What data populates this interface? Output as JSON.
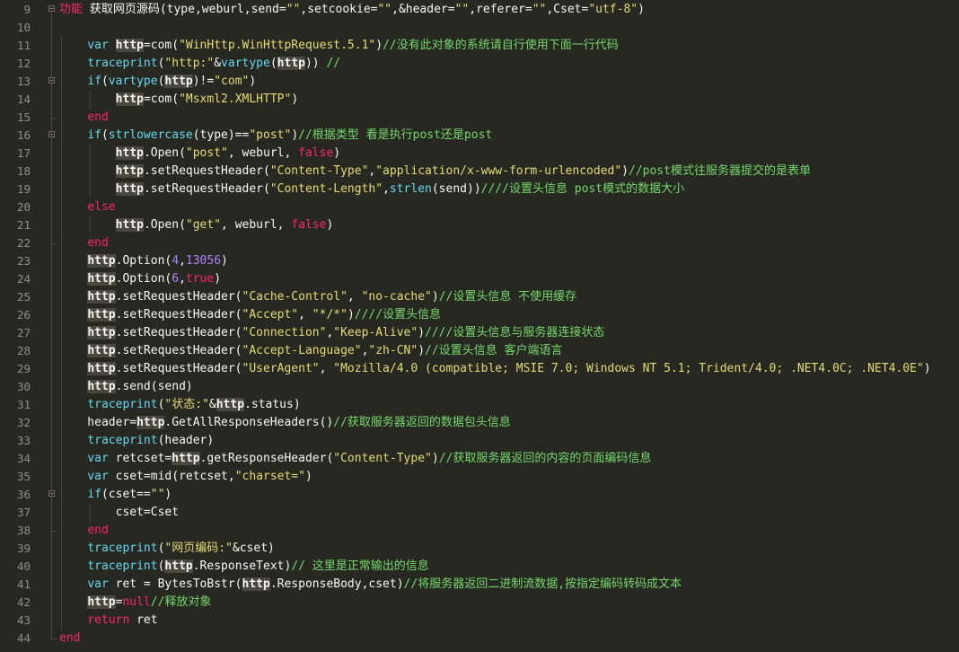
{
  "editor": {
    "lines": [
      {
        "n": "9",
        "fold": "open",
        "tokens": [
          {
            "t": "功能 ",
            "c": "ti"
          },
          {
            "t": "获取网页源码(type,weburl,send=",
            "c": ""
          },
          {
            "t": "\"\"",
            "c": "str"
          },
          {
            "t": ",setcookie=",
            "c": ""
          },
          {
            "t": "\"\"",
            "c": "str"
          },
          {
            "t": ",&header=",
            "c": ""
          },
          {
            "t": "\"\"",
            "c": "str"
          },
          {
            "t": ",referer=",
            "c": ""
          },
          {
            "t": "\"\"",
            "c": "str"
          },
          {
            "t": ",Cset=",
            "c": ""
          },
          {
            "t": "\"utf-8\"",
            "c": "str"
          },
          {
            "t": ")",
            "c": ""
          }
        ]
      },
      {
        "n": "10",
        "tokens": []
      },
      {
        "n": "11",
        "tokens": [
          {
            "t": "    ",
            "c": ""
          },
          {
            "t": "var",
            "c": "fn"
          },
          {
            "t": " ",
            "c": ""
          },
          {
            "t": "http",
            "c": "hl"
          },
          {
            "t": "=com(",
            "c": ""
          },
          {
            "t": "\"WinHttp.WinHttpRequest.5.1\"",
            "c": "str"
          },
          {
            "t": ")",
            "c": ""
          },
          {
            "t": "//没有此对象的系统请自行使用下面一行代码",
            "c": "cm"
          }
        ]
      },
      {
        "n": "12",
        "tokens": [
          {
            "t": "    ",
            "c": ""
          },
          {
            "t": "traceprint",
            "c": "fn"
          },
          {
            "t": "(",
            "c": ""
          },
          {
            "t": "\"http:\"",
            "c": "str"
          },
          {
            "t": "&",
            "c": ""
          },
          {
            "t": "vartype",
            "c": "fn"
          },
          {
            "t": "(",
            "c": ""
          },
          {
            "t": "http",
            "c": "hl"
          },
          {
            "t": ")) ",
            "c": ""
          },
          {
            "t": "//",
            "c": "cm"
          }
        ]
      },
      {
        "n": "13",
        "fold": "open",
        "tokens": [
          {
            "t": "    ",
            "c": ""
          },
          {
            "t": "if",
            "c": "fn"
          },
          {
            "t": "(",
            "c": ""
          },
          {
            "t": "vartype",
            "c": "fn"
          },
          {
            "t": "(",
            "c": ""
          },
          {
            "t": "http",
            "c": "hl"
          },
          {
            "t": ")!=",
            "c": ""
          },
          {
            "t": "\"com\"",
            "c": "str"
          },
          {
            "t": ")",
            "c": ""
          }
        ]
      },
      {
        "n": "14",
        "tokens": [
          {
            "t": "        ",
            "c": ""
          },
          {
            "t": "http",
            "c": "hl"
          },
          {
            "t": "=com(",
            "c": ""
          },
          {
            "t": "\"Msxml2.XMLHTTP\"",
            "c": "str"
          },
          {
            "t": ")",
            "c": ""
          }
        ]
      },
      {
        "n": "15",
        "tokens": [
          {
            "t": "    ",
            "c": ""
          },
          {
            "t": "end",
            "c": "kw"
          }
        ]
      },
      {
        "n": "16",
        "fold": "open",
        "tokens": [
          {
            "t": "    ",
            "c": ""
          },
          {
            "t": "if",
            "c": "fn"
          },
          {
            "t": "(",
            "c": ""
          },
          {
            "t": "strlowercase",
            "c": "fn"
          },
          {
            "t": "(type)==",
            "c": ""
          },
          {
            "t": "\"post\"",
            "c": "str"
          },
          {
            "t": ")",
            "c": ""
          },
          {
            "t": "//根据类型 看是执行post还是post",
            "c": "cm"
          }
        ]
      },
      {
        "n": "17",
        "tokens": [
          {
            "t": "        ",
            "c": ""
          },
          {
            "t": "http",
            "c": "hl"
          },
          {
            "t": ".Open(",
            "c": ""
          },
          {
            "t": "\"post\"",
            "c": "str"
          },
          {
            "t": ", weburl, ",
            "c": ""
          },
          {
            "t": "false",
            "c": "kw"
          },
          {
            "t": ")",
            "c": ""
          }
        ]
      },
      {
        "n": "18",
        "tokens": [
          {
            "t": "        ",
            "c": ""
          },
          {
            "t": "http",
            "c": "hl"
          },
          {
            "t": ".setRequestHeader(",
            "c": ""
          },
          {
            "t": "\"Content-Type\"",
            "c": "str"
          },
          {
            "t": ",",
            "c": ""
          },
          {
            "t": "\"application/x-www-form-urlencoded\"",
            "c": "str"
          },
          {
            "t": ")",
            "c": ""
          },
          {
            "t": "//post模式往服务器提交的是表单",
            "c": "cm"
          }
        ]
      },
      {
        "n": "19",
        "tokens": [
          {
            "t": "        ",
            "c": ""
          },
          {
            "t": "http",
            "c": "hl"
          },
          {
            "t": ".setRequestHeader(",
            "c": ""
          },
          {
            "t": "\"Content-Length\"",
            "c": "str"
          },
          {
            "t": ",",
            "c": ""
          },
          {
            "t": "strlen",
            "c": "fn"
          },
          {
            "t": "(send))",
            "c": ""
          },
          {
            "t": "////设置头信息 post模式的数据大小",
            "c": "cm"
          }
        ]
      },
      {
        "n": "20",
        "tokens": [
          {
            "t": "    ",
            "c": ""
          },
          {
            "t": "else",
            "c": "kw"
          }
        ]
      },
      {
        "n": "21",
        "tokens": [
          {
            "t": "        ",
            "c": ""
          },
          {
            "t": "http",
            "c": "hl"
          },
          {
            "t": ".Open(",
            "c": ""
          },
          {
            "t": "\"get\"",
            "c": "str"
          },
          {
            "t": ", weburl, ",
            "c": ""
          },
          {
            "t": "false",
            "c": "kw"
          },
          {
            "t": ")",
            "c": ""
          }
        ]
      },
      {
        "n": "22",
        "tokens": [
          {
            "t": "    ",
            "c": ""
          },
          {
            "t": "end",
            "c": "kw"
          }
        ]
      },
      {
        "n": "23",
        "tokens": [
          {
            "t": "    ",
            "c": ""
          },
          {
            "t": "http",
            "c": "hl"
          },
          {
            "t": ".Option(",
            "c": ""
          },
          {
            "t": "4",
            "c": "num"
          },
          {
            "t": ",",
            "c": ""
          },
          {
            "t": "13056",
            "c": "num"
          },
          {
            "t": ")",
            "c": ""
          }
        ]
      },
      {
        "n": "24",
        "tokens": [
          {
            "t": "    ",
            "c": ""
          },
          {
            "t": "http",
            "c": "hl"
          },
          {
            "t": ".Option(",
            "c": ""
          },
          {
            "t": "6",
            "c": "num"
          },
          {
            "t": ",",
            "c": ""
          },
          {
            "t": "true",
            "c": "kw"
          },
          {
            "t": ")",
            "c": ""
          }
        ]
      },
      {
        "n": "25",
        "tokens": [
          {
            "t": "    ",
            "c": ""
          },
          {
            "t": "http",
            "c": "hl"
          },
          {
            "t": ".setRequestHeader(",
            "c": ""
          },
          {
            "t": "\"Cache-Control\"",
            "c": "str"
          },
          {
            "t": ", ",
            "c": ""
          },
          {
            "t": "\"no-cache\"",
            "c": "str"
          },
          {
            "t": ")",
            "c": ""
          },
          {
            "t": "//设置头信息 不使用缓存",
            "c": "cm"
          }
        ]
      },
      {
        "n": "26",
        "tokens": [
          {
            "t": "    ",
            "c": ""
          },
          {
            "t": "http",
            "c": "hl"
          },
          {
            "t": ".setRequestHeader(",
            "c": ""
          },
          {
            "t": "\"Accept\"",
            "c": "str"
          },
          {
            "t": ", ",
            "c": ""
          },
          {
            "t": "\"*/*\"",
            "c": "str"
          },
          {
            "t": ")",
            "c": ""
          },
          {
            "t": "////设置头信息",
            "c": "cm"
          }
        ]
      },
      {
        "n": "27",
        "tokens": [
          {
            "t": "    ",
            "c": ""
          },
          {
            "t": "http",
            "c": "hl"
          },
          {
            "t": ".setRequestHeader(",
            "c": ""
          },
          {
            "t": "\"Connection\"",
            "c": "str"
          },
          {
            "t": ",",
            "c": ""
          },
          {
            "t": "\"Keep-Alive\"",
            "c": "str"
          },
          {
            "t": ")",
            "c": ""
          },
          {
            "t": "////设置头信息与服务器连接状态",
            "c": "cm"
          }
        ]
      },
      {
        "n": "28",
        "tokens": [
          {
            "t": "    ",
            "c": ""
          },
          {
            "t": "http",
            "c": "hl"
          },
          {
            "t": ".setRequestHeader(",
            "c": ""
          },
          {
            "t": "\"Accept-Language\"",
            "c": "str"
          },
          {
            "t": ",",
            "c": ""
          },
          {
            "t": "\"zh-CN\"",
            "c": "str"
          },
          {
            "t": ")",
            "c": ""
          },
          {
            "t": "//设置头信息 客户端语言",
            "c": "cm"
          }
        ]
      },
      {
        "n": "29",
        "tokens": [
          {
            "t": "    ",
            "c": ""
          },
          {
            "t": "http",
            "c": "hl"
          },
          {
            "t": ".setRequestHeader(",
            "c": ""
          },
          {
            "t": "\"UserAgent\"",
            "c": "str"
          },
          {
            "t": ", ",
            "c": ""
          },
          {
            "t": "\"Mozilla/4.0 (compatible; MSIE 7.0; Windows NT 5.1; Trident/4.0; .NET4.0C; .NET4.0E\"",
            "c": "str"
          },
          {
            "t": ")",
            "c": ""
          }
        ]
      },
      {
        "n": "30",
        "tokens": [
          {
            "t": "    ",
            "c": ""
          },
          {
            "t": "http",
            "c": "hl"
          },
          {
            "t": ".send(send)",
            "c": ""
          }
        ]
      },
      {
        "n": "31",
        "tokens": [
          {
            "t": "    ",
            "c": ""
          },
          {
            "t": "traceprint",
            "c": "fn"
          },
          {
            "t": "(",
            "c": ""
          },
          {
            "t": "\"状态:\"",
            "c": "str"
          },
          {
            "t": "&",
            "c": ""
          },
          {
            "t": "http",
            "c": "hl"
          },
          {
            "t": ".status)",
            "c": ""
          }
        ]
      },
      {
        "n": "32",
        "tokens": [
          {
            "t": "    header=",
            "c": ""
          },
          {
            "t": "http",
            "c": "hl"
          },
          {
            "t": ".GetAllResponseHeaders()",
            "c": ""
          },
          {
            "t": "//获取服务器返回的数据包头信息",
            "c": "cm"
          }
        ]
      },
      {
        "n": "33",
        "tokens": [
          {
            "t": "    ",
            "c": ""
          },
          {
            "t": "traceprint",
            "c": "fn"
          },
          {
            "t": "(header)",
            "c": ""
          }
        ]
      },
      {
        "n": "34",
        "tokens": [
          {
            "t": "    ",
            "c": ""
          },
          {
            "t": "var",
            "c": "fn"
          },
          {
            "t": " retcset=",
            "c": ""
          },
          {
            "t": "http",
            "c": "hl"
          },
          {
            "t": ".getResponseHeader(",
            "c": ""
          },
          {
            "t": "\"Content-Type\"",
            "c": "str"
          },
          {
            "t": ")",
            "c": ""
          },
          {
            "t": "//获取服务器返回的内容的页面编码信息",
            "c": "cm"
          }
        ]
      },
      {
        "n": "35",
        "tokens": [
          {
            "t": "    ",
            "c": ""
          },
          {
            "t": "var",
            "c": "fn"
          },
          {
            "t": " cset=mid(retcset,",
            "c": ""
          },
          {
            "t": "\"charset=\"",
            "c": "str"
          },
          {
            "t": ")",
            "c": ""
          }
        ]
      },
      {
        "n": "36",
        "fold": "open",
        "tokens": [
          {
            "t": "    ",
            "c": ""
          },
          {
            "t": "if",
            "c": "fn"
          },
          {
            "t": "(cset==",
            "c": ""
          },
          {
            "t": "\"\"",
            "c": "str"
          },
          {
            "t": ")",
            "c": ""
          }
        ]
      },
      {
        "n": "37",
        "tokens": [
          {
            "t": "        cset=Cset",
            "c": ""
          }
        ]
      },
      {
        "n": "38",
        "tokens": [
          {
            "t": "    ",
            "c": ""
          },
          {
            "t": "end",
            "c": "kw"
          }
        ]
      },
      {
        "n": "39",
        "tokens": [
          {
            "t": "    ",
            "c": ""
          },
          {
            "t": "traceprint",
            "c": "fn"
          },
          {
            "t": "(",
            "c": ""
          },
          {
            "t": "\"网页编码:\"",
            "c": "str"
          },
          {
            "t": "&cset)",
            "c": ""
          }
        ]
      },
      {
        "n": "40",
        "tokens": [
          {
            "t": "    ",
            "c": ""
          },
          {
            "t": "traceprint",
            "c": "fn"
          },
          {
            "t": "(",
            "c": ""
          },
          {
            "t": "http",
            "c": "hl"
          },
          {
            "t": ".ResponseText)",
            "c": ""
          },
          {
            "t": "// 这里是正常输出的信息",
            "c": "cm"
          }
        ]
      },
      {
        "n": "41",
        "tokens": [
          {
            "t": "    ",
            "c": ""
          },
          {
            "t": "var",
            "c": "fn"
          },
          {
            "t": " ret = BytesToBstr(",
            "c": ""
          },
          {
            "t": "http",
            "c": "hl"
          },
          {
            "t": ".ResponseBody,cset)",
            "c": ""
          },
          {
            "t": "//将服务器返回二进制流数据,按指定编码转码成文本",
            "c": "cm"
          }
        ]
      },
      {
        "n": "42",
        "tokens": [
          {
            "t": "    ",
            "c": ""
          },
          {
            "t": "http",
            "c": "hl"
          },
          {
            "t": "=",
            "c": ""
          },
          {
            "t": "null",
            "c": "kw"
          },
          {
            "t": "//释放对象",
            "c": "cm"
          }
        ]
      },
      {
        "n": "43",
        "tokens": [
          {
            "t": "    ",
            "c": ""
          },
          {
            "t": "return",
            "c": "kw"
          },
          {
            "t": " ret",
            "c": ""
          }
        ]
      },
      {
        "n": "44",
        "tokens": [
          {
            "t": "end",
            "c": "kw"
          }
        ]
      }
    ],
    "colors": {
      "background": "#272822",
      "keyword": "#f92672",
      "builtin": "#66d9ef",
      "string": "#e6db74",
      "number": "#ae81ff",
      "comment": "#75d96a",
      "highlight": "#49483e"
    }
  }
}
